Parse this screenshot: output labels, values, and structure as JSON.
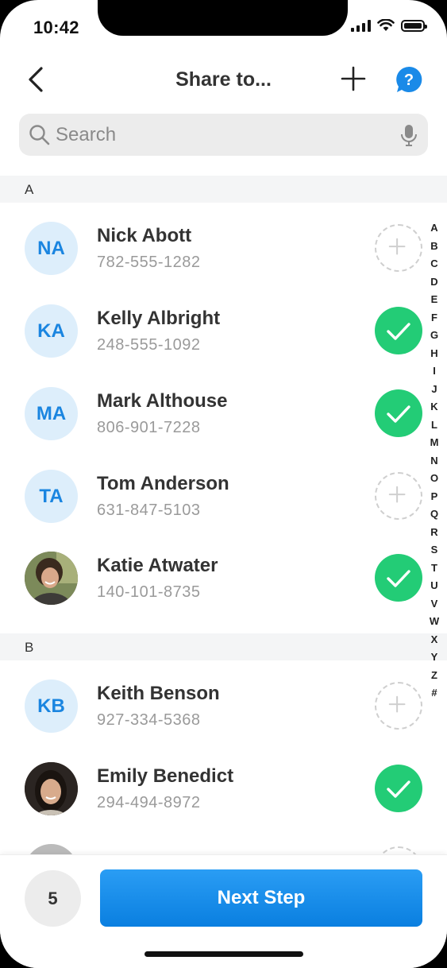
{
  "status_bar": {
    "time": "10:42"
  },
  "header": {
    "title": "Share to..."
  },
  "search": {
    "placeholder": "Search"
  },
  "sections": {
    "a": "A",
    "b": "B"
  },
  "contacts": [
    {
      "initials": "NA",
      "name": "Nick Abott",
      "phone": "782-555-1282",
      "selected": false
    },
    {
      "initials": "KA",
      "name": "Kelly Albright",
      "phone": "248-555-1092",
      "selected": true
    },
    {
      "initials": "MA",
      "name": "Mark Althouse",
      "phone": "806-901-7228",
      "selected": true
    },
    {
      "initials": "TA",
      "name": "Tom Anderson",
      "phone": "631-847-5103",
      "selected": false
    },
    {
      "initials": "",
      "name": "Katie Atwater",
      "phone": "140-101-8735",
      "selected": true
    },
    {
      "initials": "KB",
      "name": "Keith Benson",
      "phone": "927-334-5368",
      "selected": false
    },
    {
      "initials": "",
      "name": "Emily Benedict",
      "phone": "294-494-8972",
      "selected": true
    }
  ],
  "alphabet_index": [
    "A",
    "B",
    "C",
    "D",
    "E",
    "F",
    "G",
    "H",
    "I",
    "J",
    "K",
    "L",
    "M",
    "N",
    "O",
    "P",
    "Q",
    "R",
    "S",
    "T",
    "U",
    "V",
    "W",
    "X",
    "Y",
    "Z",
    "#"
  ],
  "bottom_bar": {
    "selected_count": "5",
    "next_label": "Next Step"
  },
  "colors": {
    "accent": "#1a8ae8",
    "selected": "#23cc76",
    "avatar_bg": "#ddeefb"
  }
}
